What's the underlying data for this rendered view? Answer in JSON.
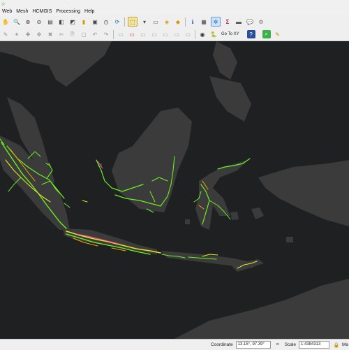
{
  "menu": {
    "items": [
      "Web",
      "Mesh",
      "HCMGIS",
      "Processing",
      "Help"
    ]
  },
  "toolbar": {
    "goto_label": "Go To XY"
  },
  "status": {
    "coordinate_label": "Coordinate",
    "coordinate_value": "13.15°, 97.39°",
    "scale_label": "Scale",
    "scale_value": "1:4384313",
    "extra_label": "Ma"
  },
  "icons": [
    "search-icon",
    "zoom-icon",
    "save-icon",
    "copy-icon",
    "clock-icon",
    "refresh-icon",
    "select-icon",
    "identify-icon",
    "settings-icon",
    "sum-icon",
    "python-icon",
    "help-icon"
  ],
  "colors": {
    "map_background": "#1f2022",
    "land": "#3b3b3b",
    "road_green": "#6cf01e",
    "road_yellow": "#e8e12a",
    "road_pink": "#ff4fa3",
    "road_orange": "#f2a400"
  }
}
